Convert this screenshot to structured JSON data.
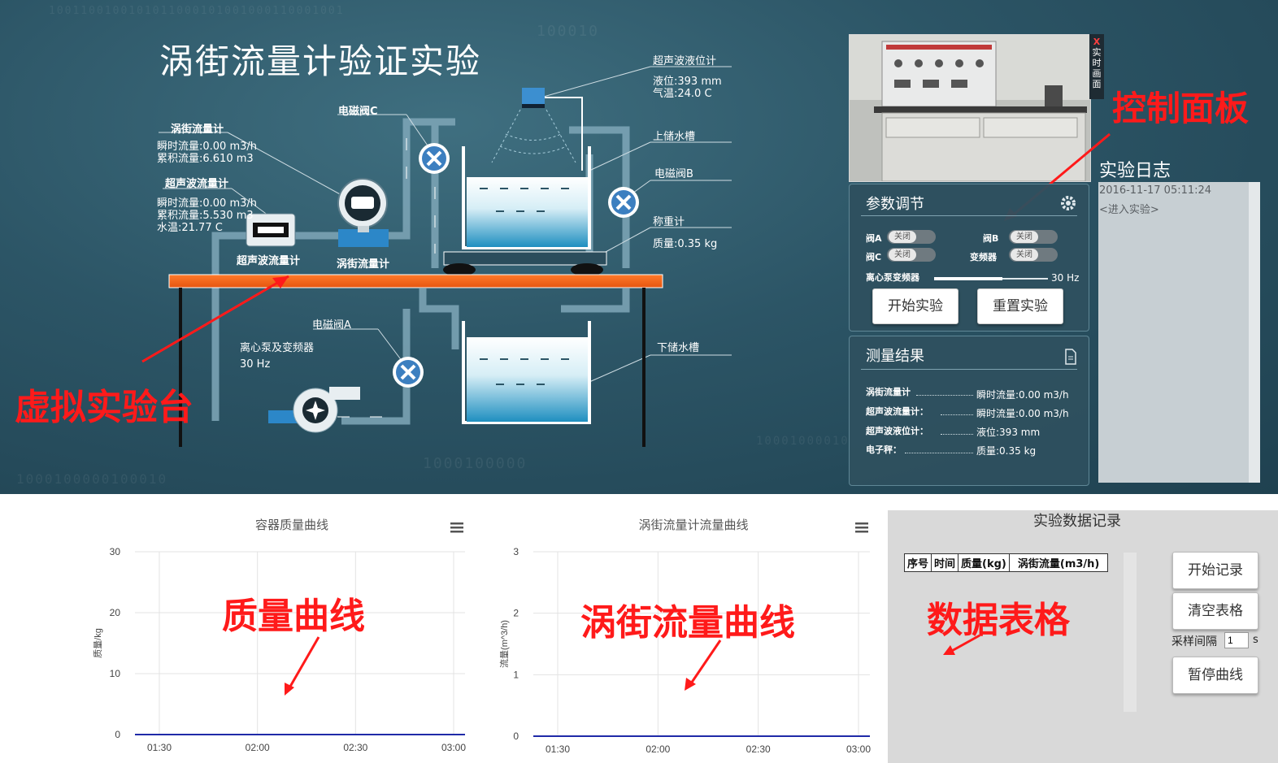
{
  "lab": {
    "title": "涡街流量计验证实验",
    "vortex_meter": {
      "header": "涡街流量计",
      "flow": "瞬时流量:0.00 m3/h",
      "total": "累积流量:6.610 m3",
      "device_label": "涡街流量计"
    },
    "ultrasonic_flow": {
      "header": "超声波流量计",
      "flow": "瞬时流量:0.00 m3/h",
      "total": "累积流量:5.530 m3",
      "temp": "水温:21.77 C",
      "device_label": "超声波流量计"
    },
    "ultrasonic_level": {
      "header": "超声波液位计",
      "level": "液位:393 mm",
      "air_temp": "气温:24.0 C"
    },
    "valve_c": "电磁阀C",
    "valve_b": "电磁阀B",
    "valve_a": "电磁阀A",
    "upper_tank": "上储水槽",
    "lower_tank": "下储水槽",
    "scale": {
      "header": "称重计",
      "mass": "质量:0.35 kg"
    },
    "pump": {
      "header": "离心泵及变频器",
      "freq": "30 Hz"
    }
  },
  "annotations": {
    "bench": "虚拟实验台",
    "control_panel": "控制面板",
    "mass_curve": "质量曲线",
    "vortex_curve": "涡街流量曲线",
    "data_table": "数据表格"
  },
  "camera": {
    "tab": "实时画面",
    "close": "X"
  },
  "params": {
    "title": "参数调节",
    "valve_a": "阀A",
    "valve_b": "阀B",
    "valve_c": "阀C",
    "inverter": "变频器",
    "toggle_off": "关闭",
    "pump_freq_label": "离心泵变频器",
    "pump_freq_value": "30 Hz",
    "pump_freq_fraction": 0.6,
    "start": "开始实验",
    "reset": "重置实验"
  },
  "results": {
    "title": "测量结果",
    "rows": [
      {
        "name": "涡街流量计",
        "value": "瞬时流量:0.00 m3/h"
      },
      {
        "name": "超声波流量计：",
        "value": "瞬时流量:0.00 m3/h"
      },
      {
        "name": "超声波液位计：",
        "value": "液位:393 mm"
      },
      {
        "name": "电子秤：",
        "value": "质量:0.35 kg"
      }
    ]
  },
  "log": {
    "title": "实验日志",
    "entries": [
      "2016-11-17 05:11:24",
      "<进入实验>"
    ]
  },
  "chart_data": [
    {
      "type": "line",
      "title": "容器质量曲线",
      "ylabel": "质量/kg",
      "xlabel": "",
      "ylim": [
        0,
        30
      ],
      "yticks": [
        "0",
        "10",
        "20",
        "30"
      ],
      "xticks": [
        "01:30",
        "02:00",
        "02:30",
        "03:00"
      ],
      "series": [
        {
          "values": [
            0,
            0,
            0,
            0
          ]
        }
      ],
      "grid": true
    },
    {
      "type": "line",
      "title": "涡街流量计流量曲线",
      "ylabel": "流量(m^3/h)",
      "xlabel": "",
      "ylim": [
        0,
        3
      ],
      "yticks": [
        "0",
        "1",
        "2",
        "3"
      ],
      "xticks": [
        "01:30",
        "02:00",
        "02:30",
        "03:00"
      ],
      "series": [
        {
          "values": [
            0,
            0,
            0,
            0
          ]
        }
      ],
      "grid": true
    }
  ],
  "record": {
    "title": "实验数据记录",
    "columns": [
      "序号",
      "时间",
      "质量(kg)",
      "涡街流量(m3/h)"
    ],
    "start": "开始记录",
    "clear": "清空表格",
    "interval_label": "采样间隔",
    "interval_value": "1",
    "interval_unit": "s",
    "pause": "暂停曲线"
  },
  "colors": {
    "accent": "#ff1a1a",
    "bench": "#f26722",
    "pipe": "#8fb3c2",
    "water": "#3aa6cf"
  }
}
